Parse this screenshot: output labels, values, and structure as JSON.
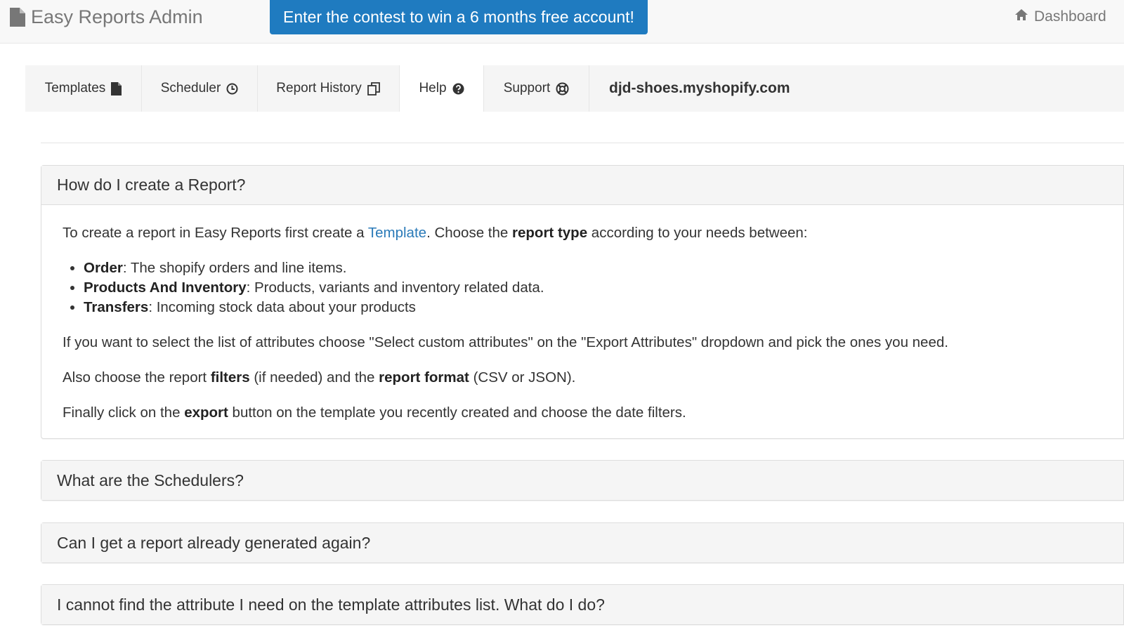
{
  "navbar": {
    "brand": "Easy Reports Admin",
    "promo": "Enter the contest to win a 6 months free account!",
    "dashboard": "Dashboard"
  },
  "tabs": [
    {
      "label": "Templates",
      "icon": "file-icon"
    },
    {
      "label": "Scheduler",
      "icon": "clock-icon"
    },
    {
      "label": "Report History",
      "icon": "copy-icon"
    },
    {
      "label": "Help",
      "icon": "question-circle-icon",
      "active": true
    },
    {
      "label": "Support",
      "icon": "life-ring-icon"
    }
  ],
  "shop": "djd-shoes.myshopify.com",
  "faq": [
    {
      "question": "How do I create a Report?",
      "expanded": true,
      "answer": {
        "intro_before_link": "To create a report in Easy Reports first create a ",
        "intro_link": "Template",
        "intro_after_link": ". Choose the ",
        "intro_bold": "report type",
        "intro_end": " according to your needs between:",
        "types": [
          {
            "name": "Order",
            "desc": ": The shopify orders and line items."
          },
          {
            "name": "Products And Inventory",
            "desc": ": Products, variants and inventory related data."
          },
          {
            "name": "Transfers",
            "desc": ": Incoming stock data about your products"
          }
        ],
        "attributes_note": "If you want to select the list of attributes choose \"Select custom attributes\" on the \"Export Attributes\" dropdown and pick the ones you need.",
        "filters_before": "Also choose the report ",
        "filters_bold": "filters",
        "filters_middle": " (if needed) and the ",
        "format_bold": "report format",
        "filters_end": " (CSV or JSON).",
        "final_before": "Finally click on the ",
        "final_bold": "export",
        "final_end": " button on the template you recently created and choose the date filters."
      }
    },
    {
      "question": "What are the Schedulers?",
      "expanded": false
    },
    {
      "question": "Can I get a report already generated again?",
      "expanded": false
    },
    {
      "question": "I cannot find the attribute I need on the template attributes list. What do I do?",
      "expanded": false
    }
  ],
  "colors": {
    "promo_bg": "#1f7bc0",
    "link": "#2a7ab8",
    "navbar_bg": "#f8f8f8"
  }
}
